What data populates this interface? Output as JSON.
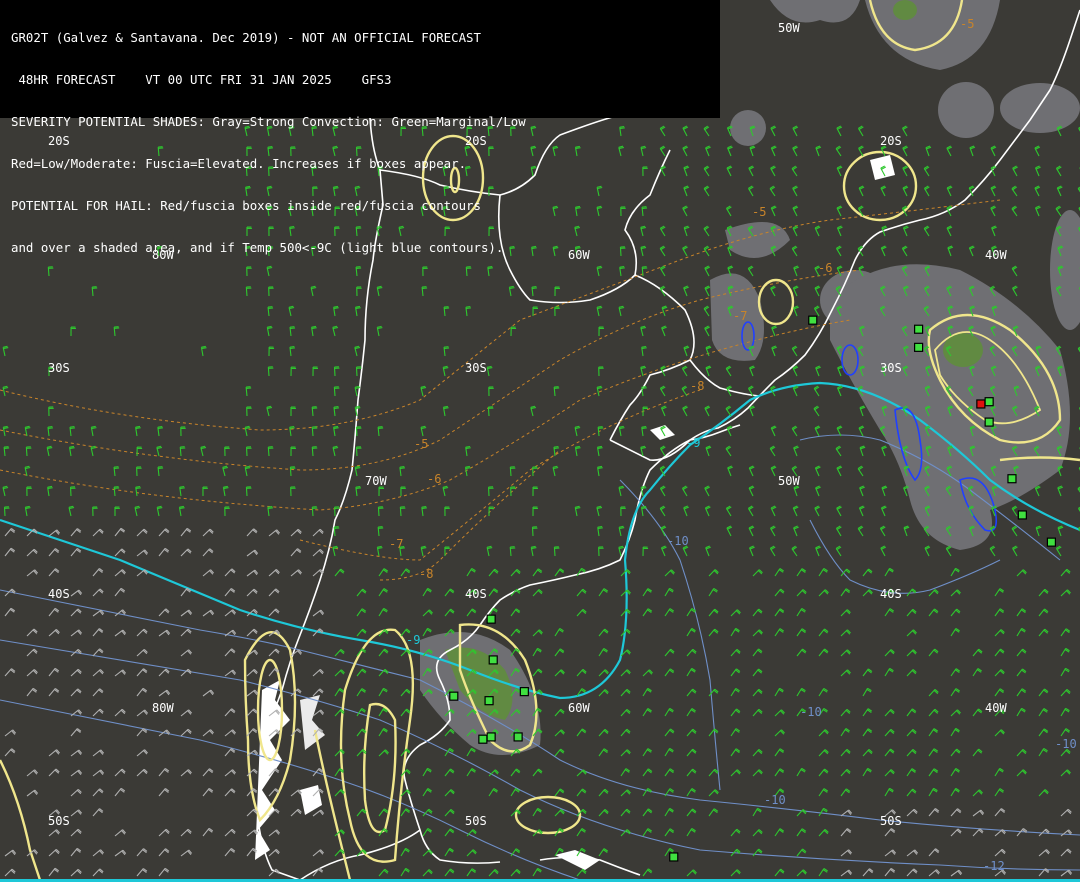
{
  "legend": {
    "lines": [
      "GR02T (Galvez & Santavana. Dec 2019) - NOT AN OFFICIAL FORECAST",
      " 48HR FORECAST    VT 00 UTC FRI 31 JAN 2025    GFS3",
      "SEVERITY POTENTIAL SHADES: Gray=Strong Convection: Green=Marginal/Low",
      "Red=Low/Moderate: Fuscia=Elevated. Increases if boxes appear.",
      "POTENTIAL FOR HAIL: Red/fuscia boxes inside red/fuscia contours",
      "and over a shaded area, and if Temp 500<-9C (light blue contours)."
    ]
  },
  "grid_labels": {
    "lat_20s": "20S",
    "lat_30s": "30S",
    "lat_40s": "40S",
    "lat_50s": "50S",
    "lon_80w": "80W",
    "lon_70w": "70W",
    "lon_60w": "60W",
    "lon_50w": "50W",
    "lon_40w": "40W"
  },
  "contour_labels": {
    "t5": "-5",
    "t6": "-6",
    "t7": "-7",
    "t8": "-8",
    "t9": "-9",
    "t10": "-10",
    "t12": "-12"
  },
  "colors": {
    "background": "#3b3a36",
    "coast": "#ffffff",
    "temp_minus9": "#1ec8d8",
    "temp_cold": "#6f8fc8",
    "temp_warm": "#c8842a",
    "severity_contour": "#f0e68c",
    "gray_shade": "#6f6f73",
    "green_shade": "#5f8f3a",
    "wind_barb": "#2ec82e",
    "wind_barb_strong": "#b0b0b0",
    "hail_box_green": "#40e040",
    "hail_box_red": "#e01010",
    "hail_contour_blue": "#2040ff"
  },
  "hail_boxes": [
    {
      "lon": -48.3,
      "lat": -27.8,
      "color": "green"
    },
    {
      "lon": -43.2,
      "lat": -28.2,
      "color": "green"
    },
    {
      "lon": -43.2,
      "lat": -29.0,
      "color": "green"
    },
    {
      "lon": -40.2,
      "lat": -31.5,
      "color": "red"
    },
    {
      "lon": -39.8,
      "lat": -31.4,
      "color": "green"
    },
    {
      "lon": -39.8,
      "lat": -32.3,
      "color": "green"
    },
    {
      "lon": -38.7,
      "lat": -34.8,
      "color": "green"
    },
    {
      "lon": -38.2,
      "lat": -36.4,
      "color": "green"
    },
    {
      "lon": -36.8,
      "lat": -37.6,
      "color": "green"
    },
    {
      "lon": -63.8,
      "lat": -41.0,
      "color": "green"
    },
    {
      "lon": -63.7,
      "lat": -42.8,
      "color": "green"
    },
    {
      "lon": -62.2,
      "lat": -44.2,
      "color": "green"
    },
    {
      "lon": -63.9,
      "lat": -44.6,
      "color": "green"
    },
    {
      "lon": -65.6,
      "lat": -44.4,
      "color": "green"
    },
    {
      "lon": -62.5,
      "lat": -46.2,
      "color": "green"
    },
    {
      "lon": -63.8,
      "lat": -46.2,
      "color": "green"
    },
    {
      "lon": -64.2,
      "lat": -46.3,
      "color": "green"
    },
    {
      "lon": -55.0,
      "lat": -51.5,
      "color": "green"
    }
  ]
}
